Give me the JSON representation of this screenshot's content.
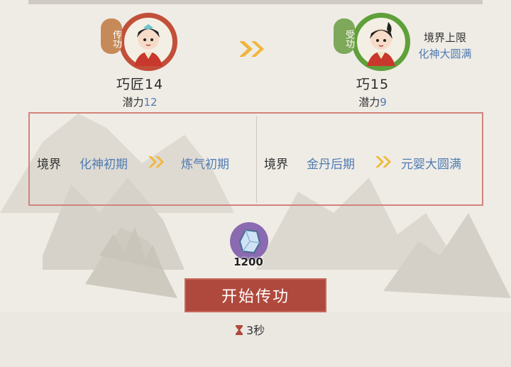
{
  "giver": {
    "tag": "传功",
    "name": "巧匠14",
    "potential_label": "潜力",
    "potential_value": "12"
  },
  "receiver": {
    "tag": "受功",
    "name": "巧15",
    "potential_label": "潜力",
    "potential_value": "9"
  },
  "realm_limit": {
    "label": "境界上限",
    "value": "化神大圆满"
  },
  "panel": {
    "left": {
      "label": "境界",
      "from": "化神初期",
      "to": "炼气初期"
    },
    "right": {
      "label": "境界",
      "from": "金丹后期",
      "to": "元婴大圆满"
    }
  },
  "cost": {
    "icon": "crystal-icon",
    "amount": "1200"
  },
  "start_button": {
    "label": "开始传功"
  },
  "timer": {
    "icon": "hourglass-icon",
    "text": "3秒"
  },
  "colors": {
    "accent_red": "#b0493d",
    "value_blue": "#4f7bb2",
    "giver_ring": "#c24f3a",
    "receiver_ring": "#5fa03b"
  }
}
